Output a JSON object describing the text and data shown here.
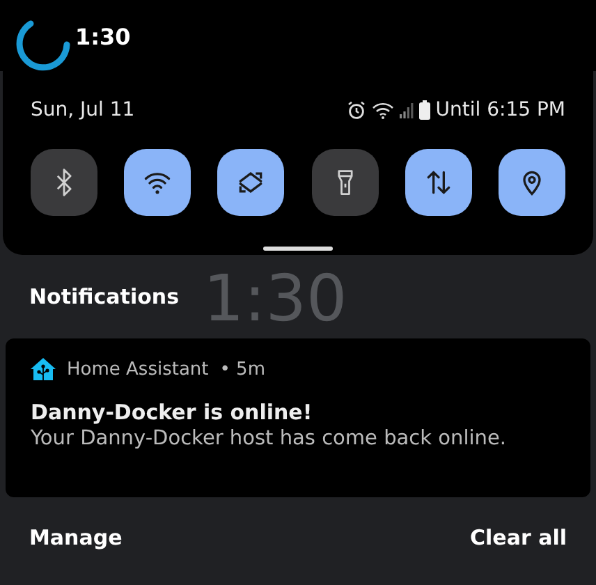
{
  "status_bar": {
    "time": "1:30"
  },
  "quick_settings": {
    "date": "Sun, Jul 11",
    "battery_text": "Until 6:15 PM",
    "tiles": [
      {
        "kind": "bluetooth",
        "on": false
      },
      {
        "kind": "wifi",
        "on": true
      },
      {
        "kind": "sync",
        "on": true
      },
      {
        "kind": "flashlight",
        "on": false
      },
      {
        "kind": "data",
        "on": true
      },
      {
        "kind": "location",
        "on": true
      }
    ]
  },
  "notifications": {
    "title": "Notifications",
    "background_clock": "1:30",
    "items": [
      {
        "app": "Home Assistant",
        "age": "• 5m",
        "title": "Danny-Docker is online!",
        "body": "Your Danny-Docker host has come back online."
      }
    ],
    "manage": "Manage",
    "clear_all": "Clear all"
  }
}
